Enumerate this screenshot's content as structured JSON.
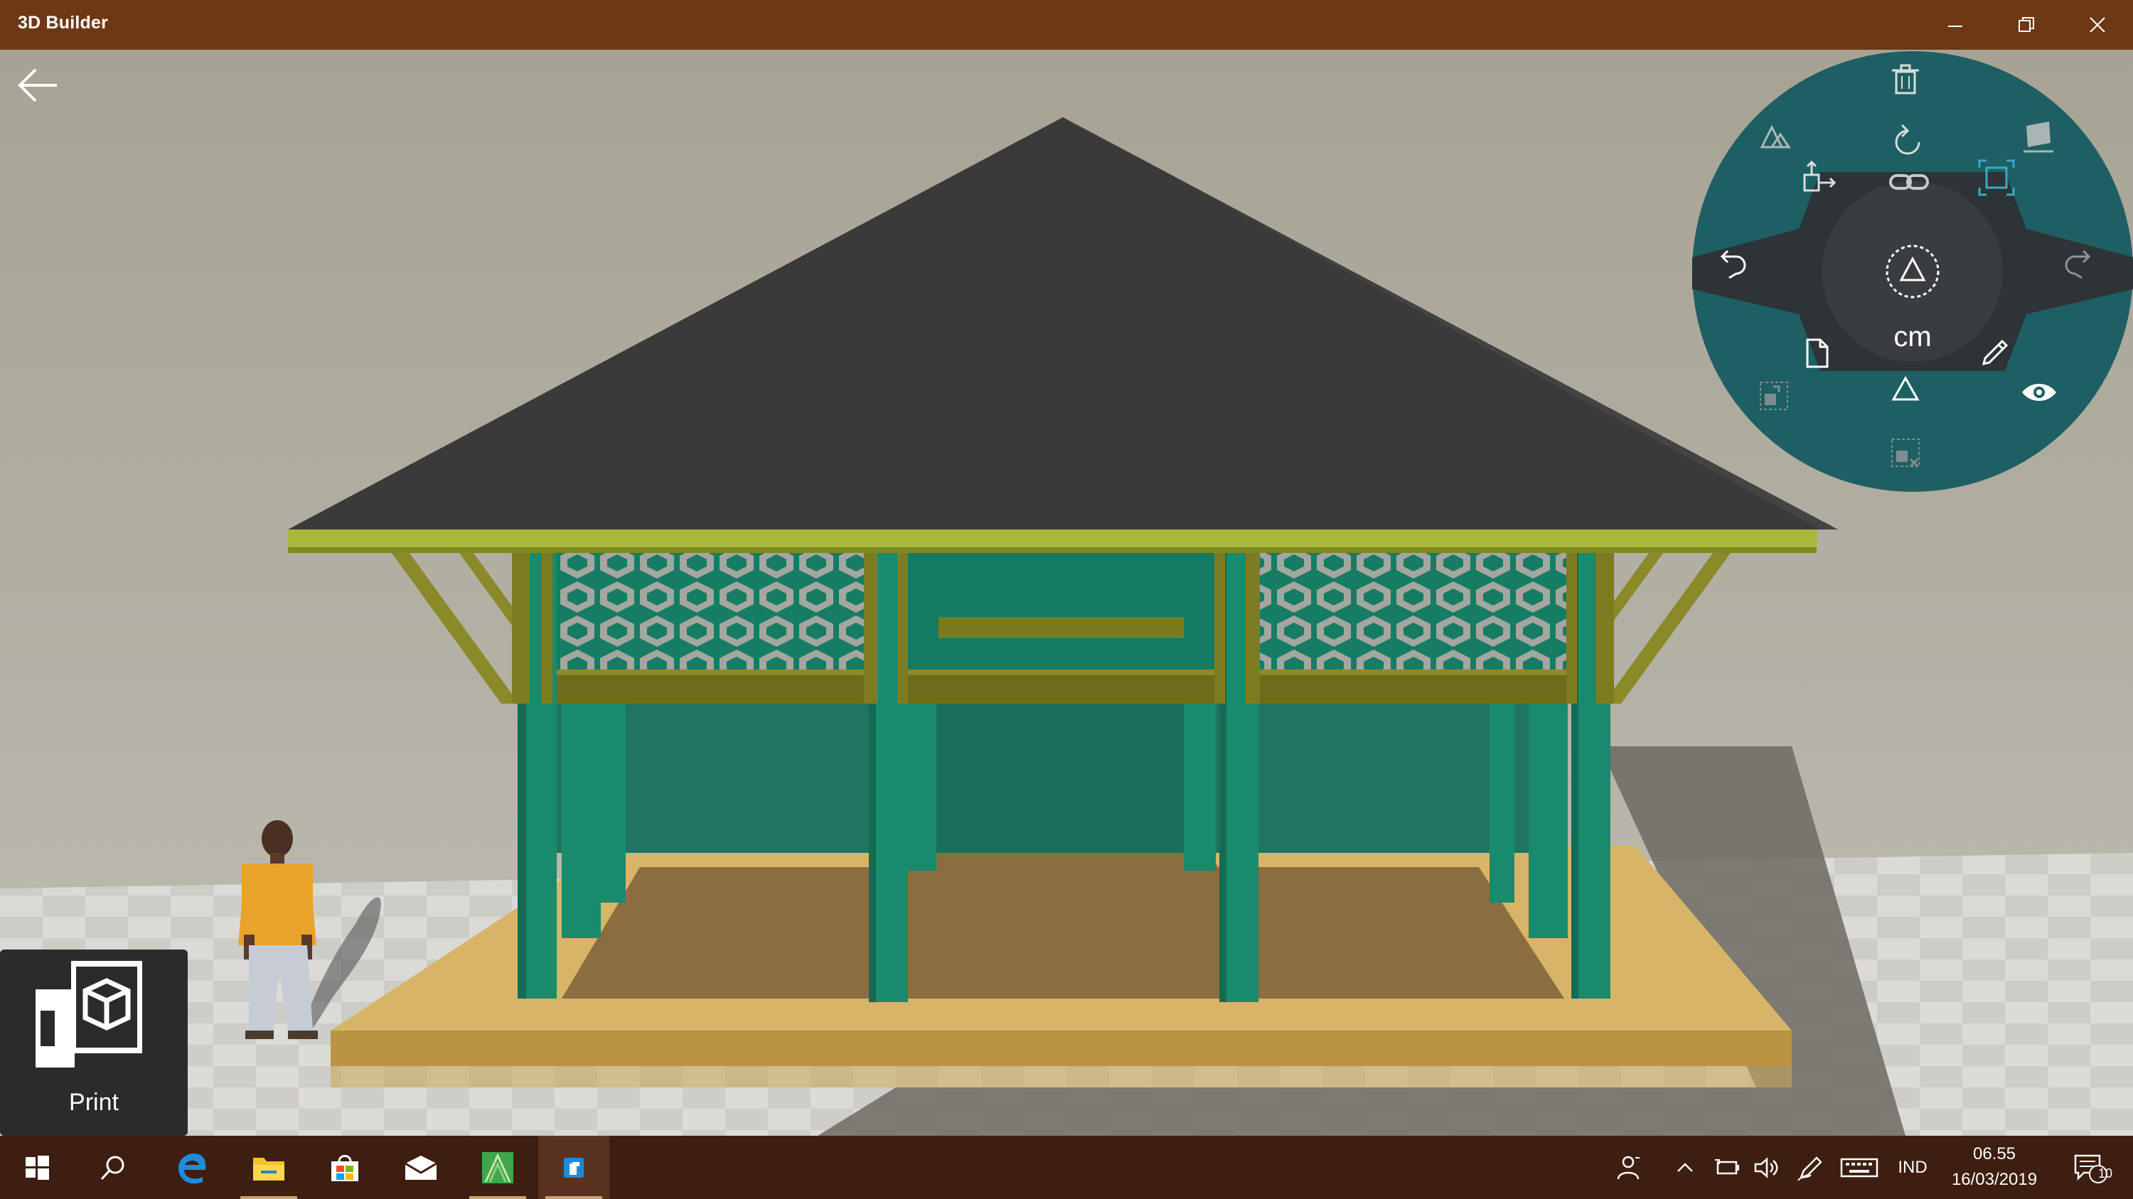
{
  "window": {
    "title": "3D Builder",
    "minimize_glyph": "—",
    "maximize_glyph": "❐",
    "close_glyph": "✕"
  },
  "canvas": {
    "back_icon": "back-arrow-icon",
    "scene": "3d-house-model"
  },
  "radial_menu": {
    "units": "cm",
    "items": [
      "trash-icon",
      "simplify-icon",
      "rotate-icon",
      "floor-icon",
      "move-icon",
      "scale-icon",
      "link-icon",
      "undo-icon",
      "select-icon",
      "redo-icon",
      "file-icon",
      "edit-icon",
      "triangle-icon",
      "duplicate-icon",
      "view-icon",
      "delete-selection-icon"
    ]
  },
  "print": {
    "label": "Print"
  },
  "taskbar": {
    "apps": [
      "start-icon",
      "search-icon",
      "edge-icon",
      "file-explorer-icon",
      "store-icon",
      "mail-icon",
      "sketchup-icon",
      "3d-builder-icon"
    ],
    "language": "IND",
    "time": "06.55",
    "date": "16/03/2019",
    "notifications": "10"
  },
  "colors": {
    "titlebar": "#6e3815",
    "taskbar": "#3d1e10",
    "radial_menu": "#1e5f63",
    "roof": "#3a3a3a",
    "walls": "#1b7862",
    "floor": "#d9b56a"
  }
}
